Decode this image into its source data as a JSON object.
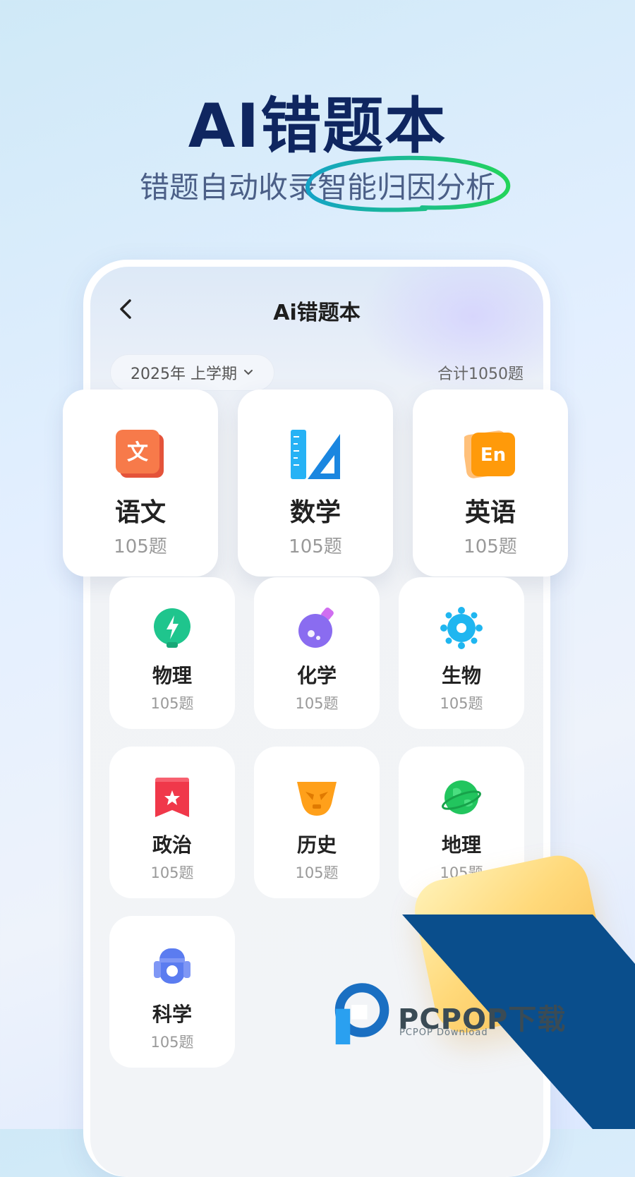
{
  "hero": {
    "title": "AI错题本",
    "subtitle_plain": "错题自动收录",
    "subtitle_highlight": "智能归因分析"
  },
  "screen": {
    "nav_title": "Ai错题本",
    "back_icon": "chevron-left-icon",
    "term_selector": "2025年 上学期",
    "term_chevron_icon": "chevron-down-icon",
    "total": "合计1050题"
  },
  "subjects": [
    {
      "name": "语文",
      "count": "105题",
      "icon": "chinese-book-icon",
      "color": "#f4663b"
    },
    {
      "name": "数学",
      "count": "105题",
      "icon": "ruler-triangle-icon",
      "color": "#1ea3f0"
    },
    {
      "name": "英语",
      "count": "105题",
      "icon": "english-en-icon",
      "color": "#ffa01a"
    },
    {
      "name": "物理",
      "count": "105题",
      "icon": "lightning-bulb-icon",
      "color": "#1fc58d"
    },
    {
      "name": "化学",
      "count": "105题",
      "icon": "flask-icon",
      "color": "#8a6cf0"
    },
    {
      "name": "生物",
      "count": "105题",
      "icon": "virus-cell-icon",
      "color": "#1fb6f0"
    },
    {
      "name": "政治",
      "count": "105题",
      "icon": "star-banner-icon",
      "color": "#f0384a"
    },
    {
      "name": "历史",
      "count": "105题",
      "icon": "bronze-mask-icon",
      "color": "#ffa01a"
    },
    {
      "name": "地理",
      "count": "105题",
      "icon": "globe-icon",
      "color": "#22c55e"
    },
    {
      "name": "科学",
      "count": "105题",
      "icon": "robot-icon",
      "color": "#5b7cf0"
    }
  ],
  "watermark": {
    "brand": "PCPOP下载",
    "sub": "PCPOP Download",
    "brand_color": "#0a4e8c"
  }
}
